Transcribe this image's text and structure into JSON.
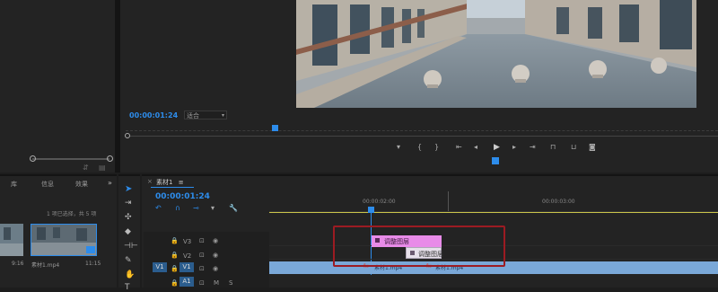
{
  "source_monitor": {
    "panel_icons": [
      "scrubber-start-icon",
      "scrubber-end-icon",
      "export-frame-icon",
      "settings-icon"
    ]
  },
  "program_monitor": {
    "timecode": "00:00:01:24",
    "fit_label": "适合",
    "transport_icons": [
      "add-marker-icon",
      "mark-in-icon",
      "mark-out-icon",
      "go-to-in-icon",
      "step-back-icon",
      "play-icon",
      "step-forward-icon",
      "go-to-out-icon",
      "lift-icon",
      "extract-icon",
      "export-frame-icon"
    ]
  },
  "project_panel": {
    "tabs": [
      "库",
      "信息",
      "效果"
    ],
    "selection_info": "1 项已选择，共 5 项",
    "clips": [
      {
        "duration": "9:16",
        "name": ""
      },
      {
        "duration": "11:15",
        "name": "素材1.mp4"
      }
    ]
  },
  "tools": [
    "selection-tool-icon",
    "track-select-tool-icon",
    "ripple-edit-tool-icon",
    "razor-tool-icon",
    "slip-tool-icon",
    "pen-tool-icon",
    "hand-tool-icon",
    "type-tool-icon"
  ],
  "timeline": {
    "sequence_name": "素材1",
    "timecode": "00:00:01:24",
    "ruler_labels": [
      "00:00:02:00",
      "00:00:03:00"
    ],
    "tracks": [
      {
        "name": "V3"
      },
      {
        "name": "V2"
      },
      {
        "name": "V1",
        "source": "V1"
      },
      {
        "name": "A1",
        "m": "M",
        "s": "S"
      }
    ],
    "clips": {
      "v3_clip": "调整图层",
      "v2_clip": "调整图层",
      "v1_clip_a": "素材1.mp4",
      "v1_clip_b": "素材1.mp4"
    }
  },
  "colors": {
    "accent": "#2d8ceb",
    "adjustment_clip": "#e88be8",
    "video_clip": "#7aa8d8",
    "highlight_box": "#9c1b22"
  }
}
